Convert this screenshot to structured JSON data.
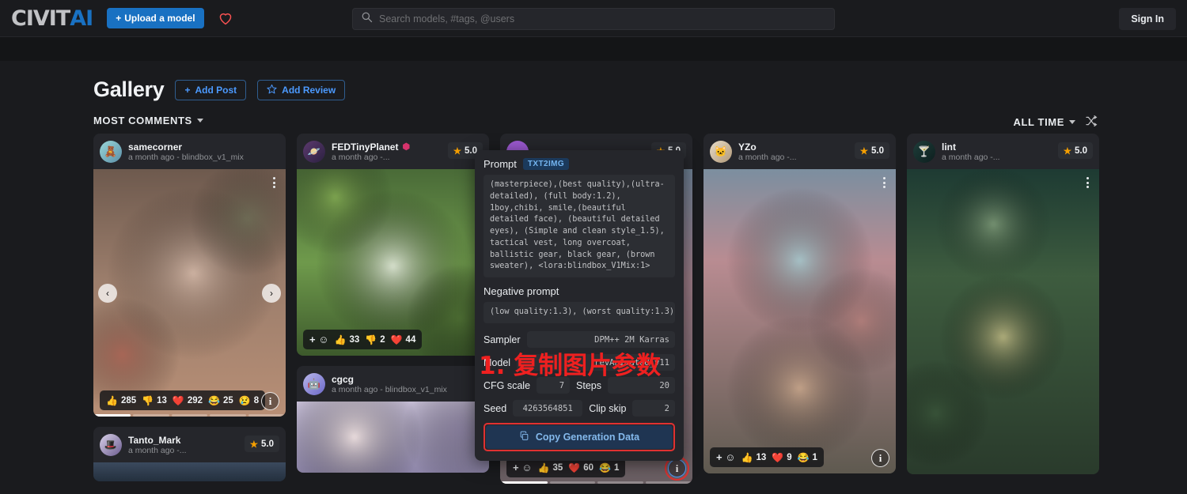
{
  "header": {
    "logo_civit": "CIVIT",
    "logo_ai": "AI",
    "upload_label": "Upload a model",
    "upload_plus": "+",
    "heart_icon": "heart-icon",
    "search_placeholder": "Search models, #tags, @users",
    "search_value": "",
    "signin_label": "Sign In"
  },
  "gallery": {
    "title": "Gallery",
    "add_post_label": "Add Post",
    "add_review_label": "Add Review",
    "sort_label": "MOST COMMENTS",
    "period_label": "ALL TIME",
    "shuffle_icon": "shuffle-icon"
  },
  "cards": [
    {
      "username": "samecorner",
      "meta": "a month ago - blindbox_v1_mix",
      "rating": null,
      "verified": false,
      "reactions": [
        {
          "emoji": "👍",
          "count": "285"
        },
        {
          "emoji": "👎",
          "count": "13"
        },
        {
          "emoji": "❤️",
          "count": "292"
        },
        {
          "emoji": "😂",
          "count": "25"
        },
        {
          "emoji": "😢",
          "count": "8"
        }
      ],
      "has_plus": false,
      "info_icon": "info-icon"
    },
    {
      "username": "Tanto_Mark",
      "meta": "a month ago -...",
      "rating": "5.0",
      "verified": false,
      "reactions": [],
      "has_plus": false,
      "info_icon": "info-icon"
    },
    {
      "username": "FEDTinyPlanet",
      "meta": "a month ago -...",
      "rating": "5.0",
      "verified": true,
      "reactions": [
        {
          "emoji": "👍",
          "count": "33"
        },
        {
          "emoji": "👎",
          "count": "2"
        },
        {
          "emoji": "❤️",
          "count": "44"
        }
      ],
      "has_plus": true,
      "info_icon": "info-icon"
    },
    {
      "username": "cgcg",
      "meta": "a month ago - blindbox_v1_mix",
      "rating": null,
      "verified": false,
      "reactions": [],
      "has_plus": false,
      "info_icon": "info-icon"
    },
    {
      "username": "",
      "meta": "",
      "rating": "5.0",
      "verified": false,
      "reactions": [
        {
          "emoji": "👍",
          "count": "35"
        },
        {
          "emoji": "❤️",
          "count": "60"
        },
        {
          "emoji": "😂",
          "count": "1"
        }
      ],
      "has_plus": true,
      "info_icon": "info-icon"
    },
    {
      "username": "YZo",
      "meta": "a month ago -...",
      "rating": "5.0",
      "verified": false,
      "reactions": [
        {
          "emoji": "👍",
          "count": "13"
        },
        {
          "emoji": "❤️",
          "count": "9"
        },
        {
          "emoji": "😂",
          "count": "1"
        }
      ],
      "has_plus": true,
      "info_icon": "info-icon"
    },
    {
      "username": "lint",
      "meta": "a month ago -...",
      "rating": "5.0",
      "verified": false,
      "reactions": [],
      "has_plus": false,
      "info_icon": "info-icon"
    }
  ],
  "meta_modal": {
    "prompt_label": "Prompt",
    "prompt_tag": "TXT2IMG",
    "prompt_text": "(masterpiece),(best quality),(ultra-detailed), (full body:1.2), 1boy,chibi, smile,(beautiful detailed face), (beautiful detailed eyes), (Simple and clean style_1.5), tactical vest, long overcoat, ballistic gear, black gear, (brown sweater), <lora:blindbox_V1Mix:1>",
    "negative_label": "Negative prompt",
    "negative_text": "(low quality:1.3), (worst quality:1.3),",
    "sampler_label": "Sampler",
    "sampler_value": "DPM++ 2M Karras",
    "model_label": "Model",
    "model_value": "revAnimated_v11",
    "cfg_label": "CFG scale",
    "cfg_value": "7",
    "steps_label": "Steps",
    "steps_value": "20",
    "seed_label": "Seed",
    "seed_value": "4263564851",
    "clipskip_label": "Clip skip",
    "clipskip_value": "2",
    "copy_label": "Copy Generation Data",
    "copy_icon": "copy-icon"
  },
  "annotation": {
    "text": "1. 复制图片参数",
    "color": "#ef2020"
  },
  "colors": {
    "accent_blue": "#1971c2",
    "link_blue": "#4c9aff",
    "page_bg": "#1a1b1e",
    "card_bg": "#25262b",
    "highlight_red": "#e03131",
    "star_gold": "#f59f00"
  }
}
